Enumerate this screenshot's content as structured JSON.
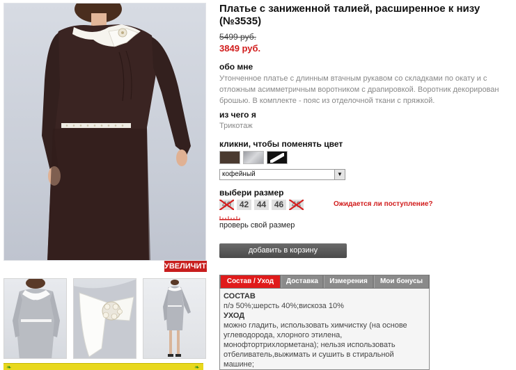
{
  "product": {
    "title": "Платье с заниженной талией, расширенное к низу (№3535)",
    "old_price": "5499 руб.",
    "new_price": "3849 руб."
  },
  "gallery": {
    "zoom_label": "УВЕЛИЧИТЬ",
    "thumbnails": [
      "thumb-front-grey",
      "thumb-brooch-detail",
      "thumb-full-grey"
    ]
  },
  "about": {
    "heading": "обо мне",
    "text": "Утонченное платье с длинным втачным рукавом со складками по окату и с отложным асимметричным воротником с драпировкой. Воротник декорирован брошью. В комплекте - пояс из отделочной ткани с пряжкой."
  },
  "material": {
    "heading": "из чего я",
    "value": "Трикотаж"
  },
  "colors": {
    "heading": "кликни, чтобы поменять цвет",
    "swatches": [
      "#4a3a30",
      "#b8babe",
      "#111111"
    ],
    "selected": "кофейный"
  },
  "sizes": {
    "heading": "выбери размер",
    "items": [
      {
        "label": "40",
        "available": false
      },
      {
        "label": "42",
        "available": true
      },
      {
        "label": "44",
        "available": true
      },
      {
        "label": "46",
        "available": true
      },
      {
        "label": "48",
        "available": false
      }
    ],
    "await_link": "Ожидается ли поступление?",
    "check_size": "проверь свой размер"
  },
  "cart": {
    "button_label": "добавить в корзину"
  },
  "tabs": {
    "items": [
      "Состав / Уход",
      "Доставка",
      "Измерения",
      "Мои бонусы"
    ],
    "active": "Состав / Уход"
  },
  "composition": {
    "heading": "СОСТАВ",
    "value": "п/э 50%;шерсть 40%;вискоза 10%",
    "care_heading": "УХОД",
    "care_text": "можно гладить, использовать химчистку (на основе углеводорода, хлорного этилена, монофтортрихлорметана); нельзя использовать отбеливатель,выжимать и сушить в стиральной машине;"
  },
  "colors_theme": {
    "accent_red": "#d11c1c",
    "tab_active": "#e01b1b",
    "tab_bar": "#7b7b7b",
    "dress_brown": "#3a2422"
  }
}
